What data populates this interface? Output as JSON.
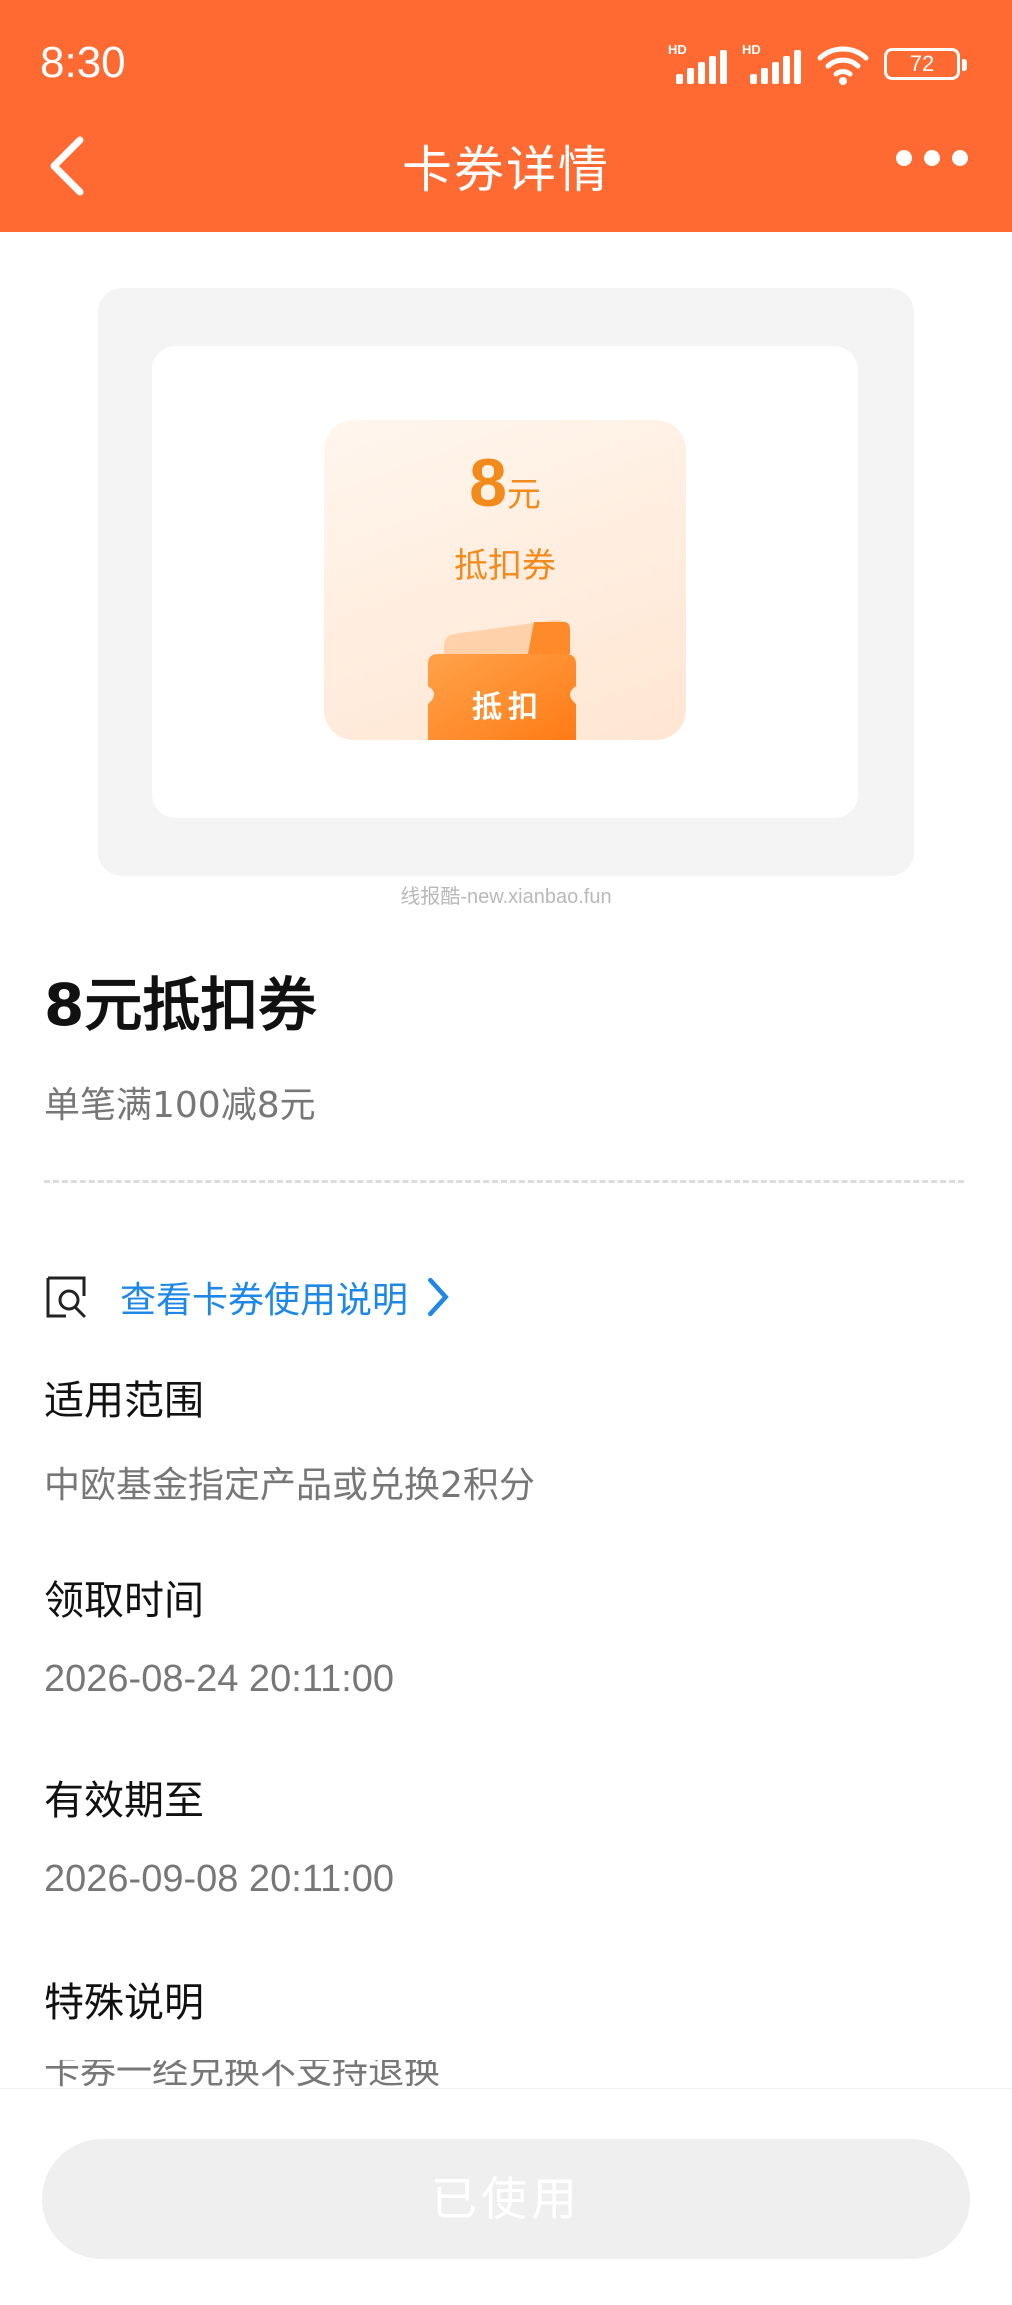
{
  "status": {
    "time": "8:30",
    "signal1_label": "HD",
    "signal2_label": "HD",
    "battery": "72"
  },
  "nav": {
    "title": "卡券详情"
  },
  "coupon_image": {
    "amount": "8",
    "unit": "元",
    "type": "抵扣券",
    "ticket_label": "抵扣"
  },
  "watermark": "线报酷-new.xianbao.fun",
  "detail": {
    "title": "8元抵扣券",
    "subtitle": "单笔满100减8元",
    "guide_link": "查看卡券使用说明",
    "scope_label": "适用范围",
    "scope_value": "中欧基金指定产品或兑换2积分",
    "receive_label": "领取时间",
    "receive_value": "2026-08-24 20:11:00",
    "expire_label": "有效期至",
    "expire_value": "2026-09-08 20:11:00",
    "special_label": "特殊说明",
    "special_value": "卡券一经兑换不支持退换"
  },
  "footer": {
    "button_label": "已使用"
  },
  "colors": {
    "header": "#ff6a33",
    "coupon_accent": "#f28a1c",
    "link": "#1f87e5"
  }
}
